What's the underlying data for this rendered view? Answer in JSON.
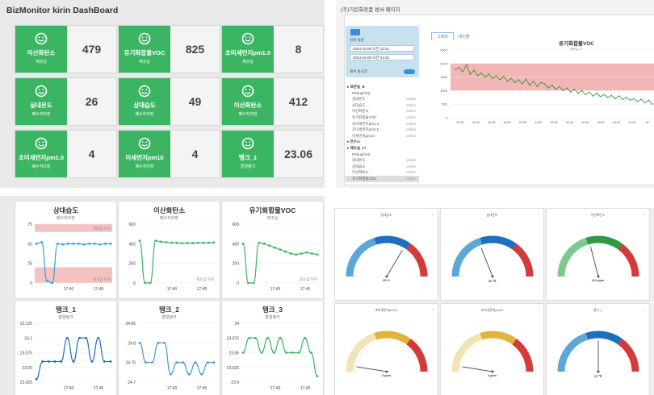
{
  "dashboard": {
    "title": "BizMonitor kirin DashBoard",
    "cards": [
      {
        "name": "이산화탄소",
        "sub": "제조실",
        "value": "479"
      },
      {
        "name": "유기화합물VOC",
        "sub": "제조실",
        "value": "825"
      },
      {
        "name": "초미세먼지pm1.0",
        "sub": "제조실",
        "value": "8"
      },
      {
        "name": "실내온도",
        "sub": "폐수처리장",
        "value": "26"
      },
      {
        "name": "상대습도",
        "sub": "폐수처리장",
        "value": "49"
      },
      {
        "name": "이산화탄소",
        "sub": "폐수처리장",
        "value": "412"
      },
      {
        "name": "초미세먼지pm1.0",
        "sub": "폐수처리장",
        "value": "4"
      },
      {
        "name": "미세먼지pm10",
        "sub": "폐수처리장",
        "value": "4"
      },
      {
        "name": "탱크_1",
        "sub": "콜렬탱크",
        "value": "23.06"
      }
    ],
    "colors": {
      "card_green": "#3cb563"
    },
    "icon": "smiley-icon"
  },
  "sensor_page": {
    "header": "(주)기린화장품 센서 페이지",
    "search_label": "검색 설정",
    "start_datetime": "2024-10-08 오전 12:31",
    "end_datetime": "2024-10-08 오전 01:32",
    "auto_label": "센서 실시간",
    "tabs": [
      "그래프",
      "테이블"
    ],
    "tree": [
      {
        "label": "▸ 표준실_B",
        "group": true
      },
      {
        "label": "PM(ug/m3)",
        "status": ""
      },
      {
        "label": "실내온도",
        "status": "online"
      },
      {
        "label": "상대습도",
        "status": "online"
      },
      {
        "label": "이산화탄소",
        "status": "online"
      },
      {
        "label": "유기화합물VOC",
        "status": "online"
      },
      {
        "label": "초미세먼지pm1.0",
        "status": "online"
      },
      {
        "label": "초미세먼지pm2.5",
        "status": "online"
      },
      {
        "label": "미세먼지pm10",
        "status": "online"
      },
      {
        "label": "▸ 연구소",
        "group": true
      },
      {
        "label": "▸ 제조실_17",
        "group": true
      },
      {
        "label": "PM(ug/m3)",
        "status": ""
      },
      {
        "label": "실내온도",
        "status": "online"
      },
      {
        "label": "상대습도",
        "status": "online"
      },
      {
        "label": "이산화탄소",
        "status": "online"
      },
      {
        "label": "유기화합물VOC",
        "status": "online",
        "selected": true
      }
    ],
    "chart_data": {
      "type": "line",
      "title": "유기화합물VOC",
      "subtitle": "제조실_17",
      "y_ticks": [
        "2500",
        "2000",
        "1500",
        "1000",
        "500",
        "0"
      ],
      "ylim": [
        0,
        2500
      ],
      "x_ticks": [
        "00:35",
        "00:40",
        "00:45",
        "00:50",
        "00:55",
        "01:00",
        "00:35",
        "00:40",
        "00:45",
        "00:50",
        "00:55",
        "01:00",
        "01:"
      ],
      "band": [
        1000,
        2000
      ],
      "colors": {
        "line": "#2e8b3a",
        "band": "#f2b6b6"
      },
      "values": [
        1780,
        1850,
        1700,
        1950,
        1600,
        1750,
        1550,
        1650,
        1500,
        1600,
        1450,
        1550,
        1400,
        1520,
        1350,
        1450,
        1300,
        1400,
        1250,
        1420,
        1200,
        1350,
        1150,
        1300,
        1250,
        1100,
        1200,
        1050,
        1150,
        1000,
        1100,
        950,
        1050,
        900,
        1000,
        850,
        950,
        800,
        900,
        780,
        850,
        750,
        820,
        700,
        800,
        680,
        750,
        650,
        700,
        600,
        680,
        550,
        650,
        500
      ]
    }
  },
  "mini_charts": [
    {
      "title": "상대습도",
      "sub": "폐수처리장",
      "type": "line",
      "ylim": [
        0,
        75
      ],
      "y_ticks": [
        "75",
        "50",
        "25",
        "0"
      ],
      "x_ticks": [
        "17:40",
        "17:45"
      ],
      "band_labels": [
        "최대값 이상",
        "최소값 이하"
      ],
      "color": "#3a9fd9",
      "values": [
        50,
        52,
        3,
        0,
        50,
        49,
        50,
        50,
        50,
        49,
        50,
        50,
        49,
        50,
        50
      ]
    },
    {
      "title": "이산화탄소",
      "sub": "폐수처리장",
      "type": "line",
      "ylim": [
        0,
        600
      ],
      "y_ticks": [
        "600",
        "400",
        "200",
        "0"
      ],
      "x_ticks": [
        "17:40",
        "17:45"
      ],
      "band_labels": [
        "최소값 이하"
      ],
      "color": "#3cb563",
      "values": [
        430,
        0,
        0,
        430,
        420,
        415,
        410,
        410,
        405,
        408,
        406,
        410,
        409,
        410,
        412
      ]
    },
    {
      "title": "유기화합물VOC",
      "sub": "제조실",
      "type": "line",
      "ylim": [
        0,
        600
      ],
      "y_ticks": [
        "600",
        "400",
        "200",
        "0"
      ],
      "x_ticks": [
        "17:40",
        "17:45"
      ],
      "band_labels": [
        "최소값 이하"
      ],
      "color": "#3cb563",
      "values": [
        400,
        0,
        0,
        410,
        400,
        380,
        360,
        340,
        320,
        300,
        290,
        300,
        310,
        300,
        290
      ]
    },
    {
      "title": "탱크_1",
      "sub": "콜렬탱크",
      "type": "line",
      "ylim": [
        23.025,
        23.125
      ],
      "y_ticks": [
        "23.125",
        "23.1",
        "23.075",
        "23.05",
        "23.025"
      ],
      "x_ticks": [
        "17:40",
        "17:45"
      ],
      "color": "#1f6fc0",
      "values": [
        23.03,
        23.06,
        23.06,
        23.06,
        23.06,
        23.1,
        23.06,
        23.1,
        23.1,
        23.06,
        23.1,
        23.06,
        23.06
      ]
    },
    {
      "title": "탱크_2",
      "sub": "콜렬탱크",
      "type": "line",
      "ylim": [
        24.7,
        24.85
      ],
      "y_ticks": [
        "24.85",
        "24.8",
        "24.75",
        "24.7"
      ],
      "x_ticks": [
        "17:40",
        "17:45"
      ],
      "color": "#3a9fd9",
      "values": [
        24.8,
        24.75,
        24.75,
        24.8,
        24.8,
        24.72,
        24.75,
        24.75,
        24.72,
        24.75,
        24.72,
        24.75,
        24.75
      ]
    },
    {
      "title": "탱크_3",
      "sub": "콜렬탱크",
      "type": "line",
      "ylim": [
        23.9,
        24
      ],
      "y_ticks": [
        "24",
        "23.975",
        "23.95",
        "23.925",
        "23.9"
      ],
      "x_ticks": [
        "17:40",
        "17:45"
      ],
      "color": "#3cb563",
      "values": [
        23.95,
        23.975,
        23.975,
        23.95,
        23.975,
        23.95,
        23.975,
        23.95,
        23.95,
        23.95,
        23.975,
        23.95,
        23.91
      ]
    }
  ],
  "gauges": [
    {
      "title": "상대습도",
      "value_text": "49 %",
      "frac": 0.67,
      "colors": [
        "#5aa7d8",
        "#1f6fc0",
        "#d33a3a"
      ]
    },
    {
      "title": "실내온도",
      "value_text": "26 ℃",
      "frac": 0.38,
      "colors": [
        "#5aa7d8",
        "#1f6fc0",
        "#d33a3a"
      ]
    },
    {
      "title": "이산화탄소",
      "value_text": "412 ppm",
      "frac": 0.42,
      "colors": [
        "#7dc98d",
        "#2e9a46",
        "#d33a3a"
      ]
    },
    {
      "title": "초미세먼지pm1.0",
      "value_text": "4 ppm",
      "frac": 0.05,
      "colors": [
        "#f1e3b5",
        "#e0b53a",
        "#d33a3a"
      ]
    },
    {
      "title": "초미세먼지pm10",
      "value_text": "4 ppm",
      "frac": 0.05,
      "colors": [
        "#f1e3b5",
        "#e0b53a",
        "#d33a3a"
      ]
    },
    {
      "title": "탱크_1",
      "value_text": "23 ℃",
      "frac": 0.5,
      "colors": [
        "#5aa7d8",
        "#1f6fc0",
        "#d33a3a"
      ]
    }
  ]
}
